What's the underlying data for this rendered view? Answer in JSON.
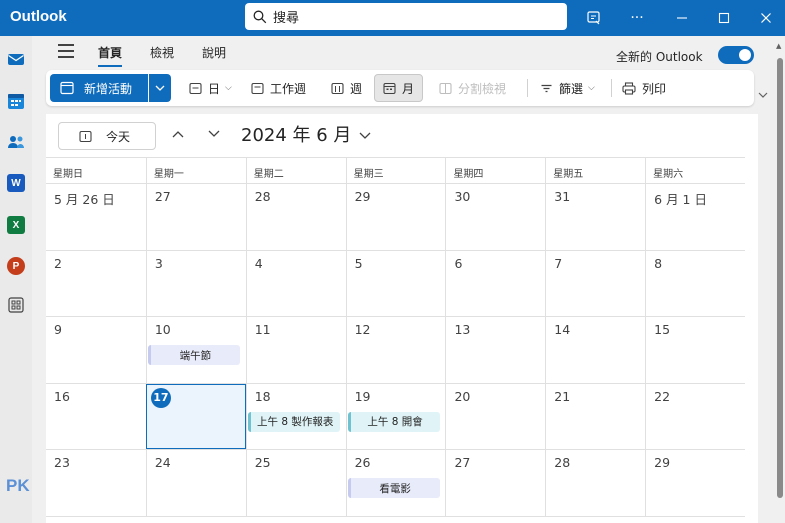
{
  "titlebar": {
    "app_name": "Outlook",
    "search_placeholder": "搜尋",
    "icons": [
      "search-icon",
      "notes-icon",
      "more-icon",
      "minimize-icon",
      "maximize-icon",
      "close-icon"
    ]
  },
  "rail": {
    "items": [
      {
        "name": "mail",
        "color": "#0f6cbd"
      },
      {
        "name": "calendar",
        "color": "#0f6cbd"
      },
      {
        "name": "people",
        "color": "#0f6cbd"
      },
      {
        "name": "word",
        "color": "#185abd",
        "letter": "W"
      },
      {
        "name": "excel",
        "color": "#107c41",
        "letter": "X"
      },
      {
        "name": "powerpoint",
        "color": "#c43e1c",
        "letter": "P"
      },
      {
        "name": "apps",
        "color": "#424242"
      }
    ]
  },
  "nav": {
    "tabs": [
      "首頁",
      "檢視",
      "說明"
    ],
    "active_tab": "首頁",
    "new_outlook_label": "全新的 Outlook",
    "new_outlook_enabled": true
  },
  "ribbon": {
    "new_event": "新增活動",
    "day": "日",
    "work_week": "工作週",
    "week": "週",
    "month": "月",
    "split_view": "分割檢視",
    "filter": "篩選",
    "print": "列印"
  },
  "calendar": {
    "today_label": "今天",
    "month_title": "2024 年 6 月",
    "weekdays": [
      "星期日",
      "星期一",
      "星期二",
      "星期三",
      "星期四",
      "星期五",
      "星期六"
    ],
    "weeks": [
      [
        {
          "label": "5 月 26 日"
        },
        {
          "label": "27"
        },
        {
          "label": "28"
        },
        {
          "label": "29"
        },
        {
          "label": "30"
        },
        {
          "label": "31"
        },
        {
          "label": "6 月 1 日"
        }
      ],
      [
        {
          "label": "2"
        },
        {
          "label": "3"
        },
        {
          "label": "4"
        },
        {
          "label": "5"
        },
        {
          "label": "6"
        },
        {
          "label": "7"
        },
        {
          "label": "8"
        }
      ],
      [
        {
          "label": "9"
        },
        {
          "label": "10",
          "event": "端午節",
          "event_style": "purple"
        },
        {
          "label": "11"
        },
        {
          "label": "12"
        },
        {
          "label": "13"
        },
        {
          "label": "14"
        },
        {
          "label": "15"
        }
      ],
      [
        {
          "label": "16"
        },
        {
          "label": "17",
          "today": true
        },
        {
          "label": "18",
          "event": "上午 8 製作報表",
          "event_style": "teal"
        },
        {
          "label": "19",
          "event": "上午 8 開會",
          "event_style": "teal"
        },
        {
          "label": "20"
        },
        {
          "label": "21"
        },
        {
          "label": "22"
        }
      ],
      [
        {
          "label": "23"
        },
        {
          "label": "24"
        },
        {
          "label": "25"
        },
        {
          "label": "26",
          "event": "看電影",
          "event_style": "purple"
        },
        {
          "label": "27"
        },
        {
          "label": "28"
        },
        {
          "label": "29"
        }
      ]
    ]
  },
  "watermark": "PK"
}
